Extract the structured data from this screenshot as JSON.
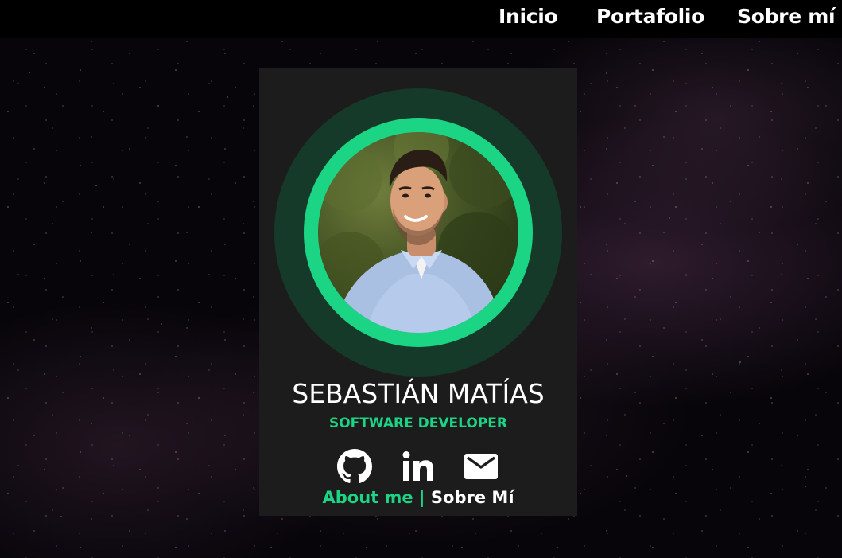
{
  "nav": {
    "items": [
      {
        "label": "Inicio"
      },
      {
        "label": "Portafolio"
      },
      {
        "label": "Sobre mí"
      }
    ]
  },
  "profile": {
    "name": "SEBASTIÁN MATÍAS",
    "role": "SOFTWARE DEVELOPER",
    "photo_alt": "Profile photo"
  },
  "social": {
    "icons": [
      "github-icon",
      "linkedin-icon",
      "mail-icon"
    ]
  },
  "footer": {
    "about_label": "About me",
    "separator": " | ",
    "sobre_label": "Sobre Mí"
  },
  "colors": {
    "accent": "#1bd585",
    "card_bg": "#1c1c1c",
    "halo": "#163a2a",
    "navbar_bg": "#000000"
  }
}
